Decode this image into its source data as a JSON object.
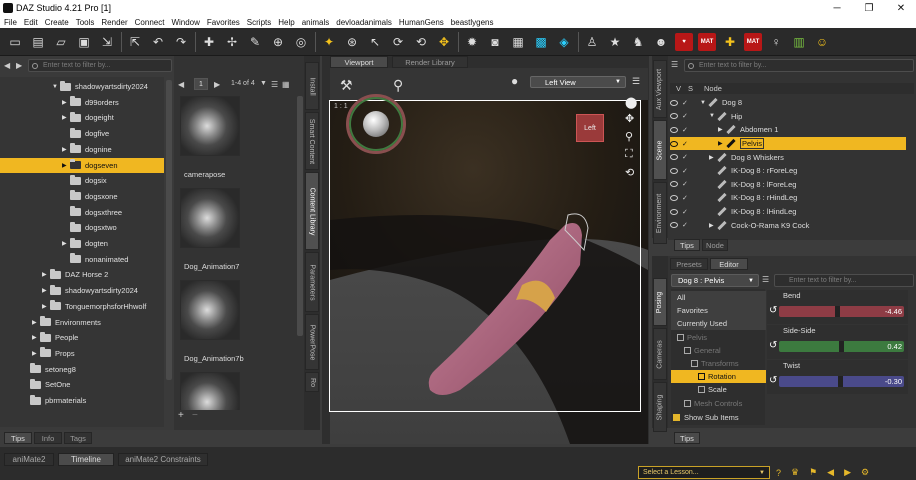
{
  "window": {
    "title": "DAZ Studio 4.21 Pro [1]"
  },
  "menu": [
    "File",
    "Edit",
    "Create",
    "Tools",
    "Render",
    "Connect",
    "Window",
    "Favorites",
    "Scripts",
    "Help",
    "animals",
    "devloadanimals",
    "HumanGens",
    "beastlygens"
  ],
  "toolbar_icons": [
    "new-file-icon",
    "open-file-icon",
    "open-folder-icon",
    "save-icon",
    "merge-icon",
    "export-icon",
    "undo-icon",
    "redo-icon",
    "add-figure-icon",
    "joint-tool-icon",
    "node-weight-icon",
    "region-tool-icon",
    "geometry-tool-icon",
    "active-pose-icon",
    "universal-tool-icon",
    "select-icon",
    "rotate-tool-icon",
    "rotate-2-icon",
    "move-tool-icon",
    "light-icon",
    "camera-icon",
    "render-icon",
    "iray-icon",
    "render-preview-icon",
    "pose-figure-icon",
    "star-figure-icon",
    "sitting-figure-icon",
    "portrait-icon",
    "skin-icon",
    "mat-copy-icon",
    "puzzle-icon",
    "mat-collect-icon",
    "wardrobe-icon",
    "apps-icon",
    "mannequin-icon"
  ],
  "content_library": {
    "filter_placeholder": "Enter text to filter by...",
    "items": [
      {
        "label": "shadowyartsdirty2024",
        "indent": 3,
        "expanded": true
      },
      {
        "label": "d99orders",
        "indent": 4,
        "expanded": false
      },
      {
        "label": "dogeight",
        "indent": 4,
        "expanded": false
      },
      {
        "label": "dogfive",
        "indent": 4,
        "expanded": null
      },
      {
        "label": "dognine",
        "indent": 4,
        "expanded": false
      },
      {
        "label": "dogseven",
        "indent": 4,
        "expanded": false,
        "selected": true
      },
      {
        "label": "dogsix",
        "indent": 4,
        "expanded": null
      },
      {
        "label": "dogsxone",
        "indent": 4,
        "expanded": null
      },
      {
        "label": "dogsxthree",
        "indent": 4,
        "expanded": null
      },
      {
        "label": "dogsxtwo",
        "indent": 4,
        "expanded": null
      },
      {
        "label": "dogten",
        "indent": 4,
        "expanded": false
      },
      {
        "label": "nonanimated",
        "indent": 4,
        "expanded": null
      },
      {
        "label": "DAZ Horse 2",
        "indent": 2,
        "expanded": false
      },
      {
        "label": "shadowyartsdirty2024",
        "indent": 2,
        "expanded": false
      },
      {
        "label": "TonguemorphsforHhwolf",
        "indent": 2,
        "expanded": false
      },
      {
        "label": "Environments",
        "indent": 1,
        "expanded": false
      },
      {
        "label": "People",
        "indent": 1,
        "expanded": false
      },
      {
        "label": "Props",
        "indent": 1,
        "expanded": false
      },
      {
        "label": "setoneg8",
        "indent": 0,
        "expanded": null
      },
      {
        "label": "SetOne",
        "indent": 0,
        "expanded": null
      },
      {
        "label": "pbrmaterials",
        "indent": 0,
        "expanded": null
      }
    ],
    "page": "1",
    "page_count": "1-4 of 4",
    "thumbnails": [
      {
        "label": "camerapose"
      },
      {
        "label": "Dog_Animation7"
      },
      {
        "label": "Dog_Animation7b"
      },
      {
        "label": ""
      }
    ],
    "bottom_tabs": [
      "Tips",
      "Info",
      "Tags"
    ],
    "side_tabs": [
      "Install",
      "Smart Content",
      "Content Library",
      "Parameters",
      "PowerPose",
      "Ro"
    ]
  },
  "viewport": {
    "tabs": [
      "Viewport",
      "Render Library"
    ],
    "view": "Left View",
    "aux_counter": "1 : 1",
    "cube_label": "Left"
  },
  "scene": {
    "filter_placeholder": "Enter text to filter by...",
    "headers": [
      "V",
      "S",
      "Node"
    ],
    "rows": [
      {
        "label": "Dog 8",
        "indent": 0,
        "type": "figure",
        "arrow": "▼"
      },
      {
        "label": "Hip",
        "indent": 1,
        "type": "bone",
        "arrow": "▼"
      },
      {
        "label": "Abdomen 1",
        "indent": 2,
        "type": "bone",
        "arrow": "▶"
      },
      {
        "label": "Pelvis",
        "indent": 2,
        "type": "bone",
        "arrow": "▶",
        "selected": true
      },
      {
        "label": "Dog 8 Whiskers",
        "indent": 1,
        "type": "figure",
        "arrow": "▶"
      },
      {
        "label": "IK-Dog 8 : rForeLeg",
        "indent": 1,
        "type": "ik",
        "arrow": ""
      },
      {
        "label": "IK-Dog 8 : lForeLeg",
        "indent": 1,
        "type": "ik",
        "arrow": ""
      },
      {
        "label": "IK-Dog 8 : rHindLeg",
        "indent": 1,
        "type": "ik",
        "arrow": ""
      },
      {
        "label": "IK-Dog 8 : lHindLeg",
        "indent": 1,
        "type": "ik",
        "arrow": ""
      },
      {
        "label": "Cock-O-Rama K9 Cock",
        "indent": 1,
        "type": "figure",
        "arrow": "▶"
      }
    ],
    "side_tabs": [
      "Aux Viewport",
      "Scene",
      "Environment"
    ],
    "bottom_tabs": [
      "Tips",
      "Node"
    ]
  },
  "posing": {
    "tabs": [
      "Presets",
      "Editor"
    ],
    "selector": "Dog 8 : Pelvis",
    "filter_placeholder": "Enter text to filter by...",
    "categories": [
      {
        "label": "All"
      },
      {
        "label": "Favorites"
      },
      {
        "label": "Currently Used"
      },
      {
        "label": "Pelvis",
        "dim": true
      },
      {
        "label": "General",
        "dim": true
      },
      {
        "label": "Transforms",
        "dim": true
      },
      {
        "label": "Rotation",
        "selected": true
      },
      {
        "label": "Scale"
      },
      {
        "label": "Mesh Controls",
        "dim": true
      }
    ],
    "show_sub_items": "Show Sub Items",
    "sliders": [
      {
        "label": "Bend",
        "value": "-4.46",
        "color": "#8e3c45",
        "level": 0.47
      },
      {
        "label": "Side-Side",
        "value": "0.42",
        "color": "#3c7a3f",
        "level": 0.5
      },
      {
        "label": "Twist",
        "value": "-0.30",
        "color": "#4a4a8a",
        "level": 0.49
      }
    ],
    "side_tabs": [
      "Posing",
      "Cameras",
      "Shaping"
    ],
    "bottom_tabs": [
      "Tips"
    ]
  },
  "timeline": {
    "tabs": [
      "aniMate2",
      "Timeline",
      "aniMate2 Constraints"
    ],
    "lesson": "Select a Lesson..."
  }
}
